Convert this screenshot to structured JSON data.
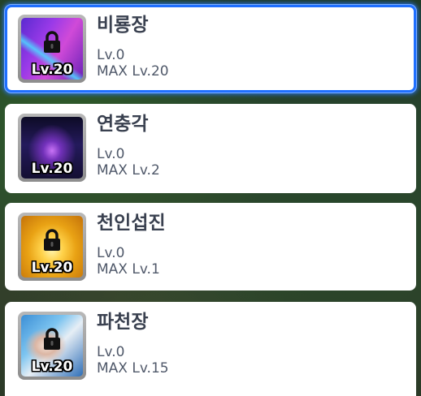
{
  "skills": [
    {
      "name": "비룡장",
      "badge": "Lv.20",
      "level": "Lv.0",
      "max": "MAX Lv.20",
      "locked": true,
      "selected": true,
      "icon": "dragon-palm-skill-icon"
    },
    {
      "name": "연충각",
      "badge": "Lv.20",
      "level": "Lv.0",
      "max": "MAX Lv.2",
      "locked": false,
      "selected": false,
      "icon": "chain-kick-skill-icon"
    },
    {
      "name": "천인섭진",
      "badge": "Lv.20",
      "level": "Lv.0",
      "max": "MAX Lv.1",
      "locked": true,
      "selected": false,
      "icon": "heavenly-strike-skill-icon"
    },
    {
      "name": "파천장",
      "badge": "Lv.20",
      "level": "Lv.0",
      "max": "MAX Lv.15",
      "locked": true,
      "selected": false,
      "icon": "sky-breaker-palm-skill-icon"
    }
  ],
  "colors": {
    "selection_border": "#1f6fff",
    "name_text": "#3a4150",
    "detail_text": "#50596a",
    "card_bg": "#ffffff"
  }
}
